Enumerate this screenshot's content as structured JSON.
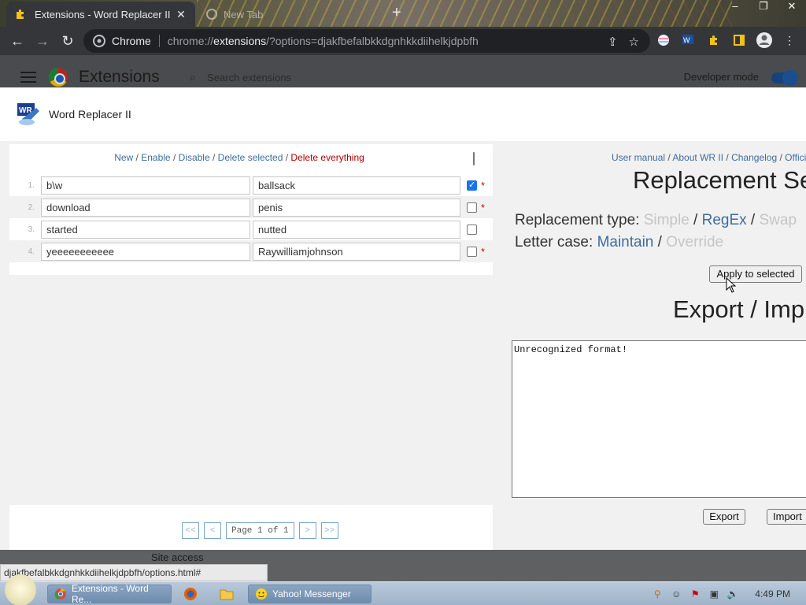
{
  "browser": {
    "active_tab_title": "Extensions - Word Replacer II",
    "inactive_tab_title": "New Tab",
    "omnibox_chip": "Chrome",
    "url_prefix": "chrome://",
    "url_host": "extensions",
    "url_rest": "/?options=djakfbefalbkkdgnhkkdiihelkjdpbfh"
  },
  "extensions_page": {
    "title": "Extensions",
    "search_placeholder": "Search extensions",
    "developer_mode_label": "Developer mode",
    "site_access_label": "Site access"
  },
  "dialog": {
    "title": "Word Replacer II",
    "actions": {
      "new": "New",
      "enable": "Enable",
      "disable": "Disable",
      "delete_selected": "Delete selected",
      "delete_everything": "Delete everything",
      "separator": " / "
    },
    "rules": [
      {
        "num": "1.",
        "from": "b\\w",
        "to": "ballsack",
        "checked": true,
        "star": "*"
      },
      {
        "num": "2.",
        "from": "download",
        "to": "penis",
        "checked": false,
        "star": "*"
      },
      {
        "num": "3.",
        "from": "started",
        "to": "nutted",
        "checked": false,
        "star": ""
      },
      {
        "num": "4.",
        "from": "yeeeeeeeeeee",
        "to": "Raywilliamjohnson",
        "checked": false,
        "star": "*"
      }
    ],
    "pager": {
      "first": "<<",
      "prev": "<",
      "label": "Page 1 of 1",
      "next": ">",
      "last": ">>"
    },
    "links": {
      "user_manual": "User manual",
      "about": "About WR II",
      "changelog": "Changelog",
      "official": "Offici"
    },
    "replacement_settings_heading": "Replacement Se",
    "replacement_type": {
      "label": "Replacement type:",
      "simple": "Simple",
      "regex": "RegEx",
      "swap": "Swap"
    },
    "letter_case": {
      "label": "Letter case:",
      "maintain": "Maintain",
      "override": "Override"
    },
    "apply_button": "Apply to selected",
    "export_heading": "Export / Imp",
    "export_text": "Unrecognized format!",
    "export_button": "Export",
    "import_button": "Import"
  },
  "status_url": "djakfbefalbkkdgnhkkdiihelkjdpbfh/options.html#",
  "taskbar": {
    "task_chrome": "Extensions - Word Re...",
    "task_messenger": "Yahoo! Messenger",
    "clock": "4:49 PM"
  },
  "colors": {
    "link_blue": "#3e6d9c",
    "danger_red": "#b00000",
    "disabled_grey": "#c5c5c5",
    "checkbox_blue": "#1a73e8"
  }
}
